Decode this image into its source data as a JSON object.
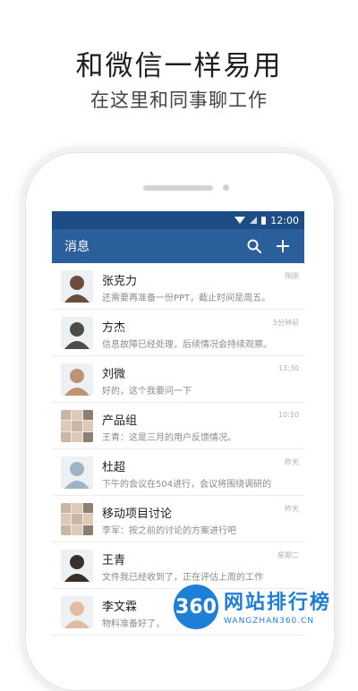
{
  "headline": "和微信一样易用",
  "subline": "在这里和同事聊工作",
  "status": {
    "time": "12:00"
  },
  "appbar": {
    "title": "消息"
  },
  "conversations": [
    {
      "name": "张克力",
      "preview": "还需要再准备一份PPT，截止时间是周五。",
      "time": "刚刚",
      "avatar": "person-man-suit",
      "color": "#6b4e3d"
    },
    {
      "name": "方杰",
      "preview": "信息故障已经处理，后续情况会持续观察。",
      "time": "5分钟前",
      "avatar": "person-man-glasses",
      "color": "#4e4d4c"
    },
    {
      "name": "刘微",
      "preview": "好的，这个我要问一下",
      "time": "13:30",
      "avatar": "person-woman",
      "color": "#c09274"
    },
    {
      "name": "产品组",
      "preview": "王青：这是三月的用户反馈情况。",
      "time": "10:10",
      "avatar": "group",
      "color": "#c9b7a4"
    },
    {
      "name": "杜超",
      "preview": "下午的会议在504进行，会议将围绕调研的",
      "time": "昨天",
      "avatar": "person-man-shirt",
      "color": "#9fb3c6"
    },
    {
      "name": "移动项目讨论",
      "preview": "李军：按之前的讨论的方案进行吧",
      "time": "昨天",
      "avatar": "group",
      "color": "#b59a86"
    },
    {
      "name": "王青",
      "preview": "文件我已经收到了，正在评估上周的工作",
      "time": "星期二",
      "avatar": "person-woman-dark-hair",
      "color": "#3b2f2a"
    },
    {
      "name": "李文霖",
      "preview": "物料准备好了，",
      "time": "",
      "avatar": "person-woman",
      "color": "#e0bca2"
    }
  ],
  "watermark": {
    "badge": "360",
    "title": "网站排行榜",
    "url": "WANGZHAN360.CN"
  }
}
